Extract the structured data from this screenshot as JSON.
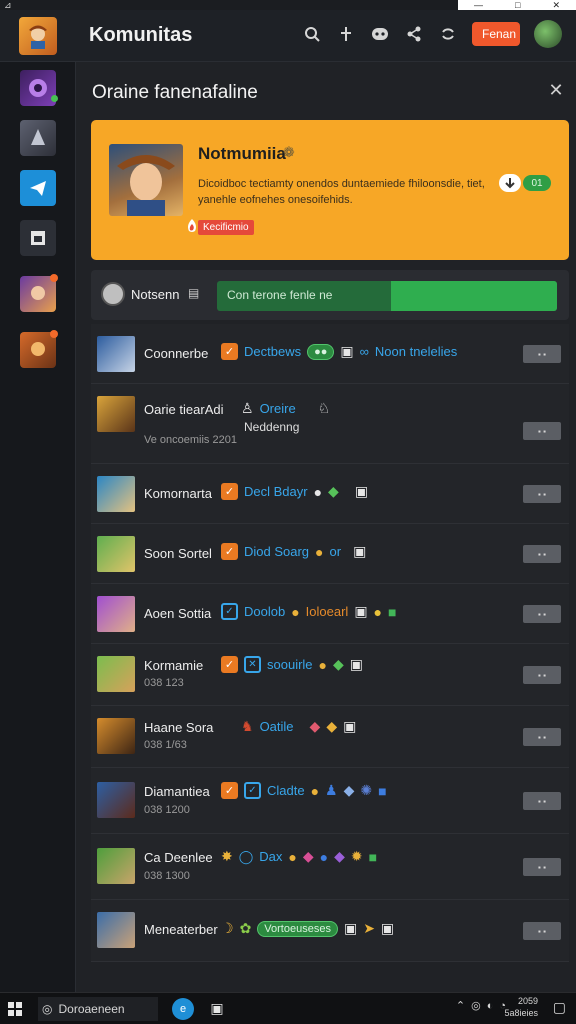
{
  "window": {
    "controls": [
      "—",
      "□",
      "✕"
    ],
    "corner_glyph": "⊿"
  },
  "header": {
    "title": "Komunitas",
    "follow_label": "Fenan",
    "icons": [
      "search-icon",
      "pin-icon",
      "discord-icon",
      "share-icon",
      "refresh-icon"
    ]
  },
  "sidebar": {
    "items": [
      "game-1",
      "game-2",
      "telegram",
      "app-4",
      "game-5",
      "game-6"
    ]
  },
  "panel": {
    "title": "Oraine fanenafaline",
    "close_glyph": "✕"
  },
  "featured": {
    "title": "Notmumiia",
    "title_icon": "❁",
    "description": "Dicoidboc tectiamty onendos duntaemiede fhiloonsdie, tiet, yanehle eofnehes onesoifehids.",
    "tag": "Kecificmio",
    "status_pill": "01"
  },
  "member_row": {
    "label": "Notsenn",
    "keyboard_glyph": "▤",
    "input_placeholder": "Con terone fenle ne"
  },
  "rows": [
    {
      "name": "Coonnerbe",
      "sub": "",
      "tag1": "Dectbews",
      "tag2": "Noon tnelelies",
      "btn": "▪ ▪"
    },
    {
      "name": "Oarie tiearAdi",
      "sub": "Ve oncoemiis 2201",
      "extra": "Oreire",
      "extra2": "Neddenng",
      "btn": "▪ ▪"
    },
    {
      "name": "Komornarta",
      "sub": "",
      "tag1": "Decl Bdayr",
      "btn": "▪ ▪"
    },
    {
      "name": "Soon Sortel",
      "sub": "",
      "tag1": "Diod Soarg",
      "tag_extra": "or",
      "btn": "▪ ▪"
    },
    {
      "name": "Aoen Sottia",
      "sub": "",
      "tag1": "Doolob",
      "tag_extra": "Ioloearl",
      "btn": "▪ ▪"
    },
    {
      "name": "Kormamie",
      "sub": "038 123",
      "tag1": "soouirle",
      "btn": "▪ ▪"
    },
    {
      "name": "Haane Sora",
      "sub": "038 1/63",
      "tag1": "Oatile",
      "btn": "▪ ▪"
    },
    {
      "name": "Diamantiea",
      "sub": "038 1200",
      "tag1": "Cladte",
      "btn": "▪ ▪"
    },
    {
      "name": "Ca Deenlee",
      "sub": "038 1300",
      "tag1": "Dax",
      "btn": "▪ ▪"
    },
    {
      "name": "Meneaterber",
      "sub": "",
      "tag1": "Vortoeuseses",
      "btn": "▪ ▪"
    }
  ],
  "taskbar": {
    "search_label": "Doroaeneen",
    "time_line1": "2059",
    "time_line2": "5a8ieies"
  }
}
